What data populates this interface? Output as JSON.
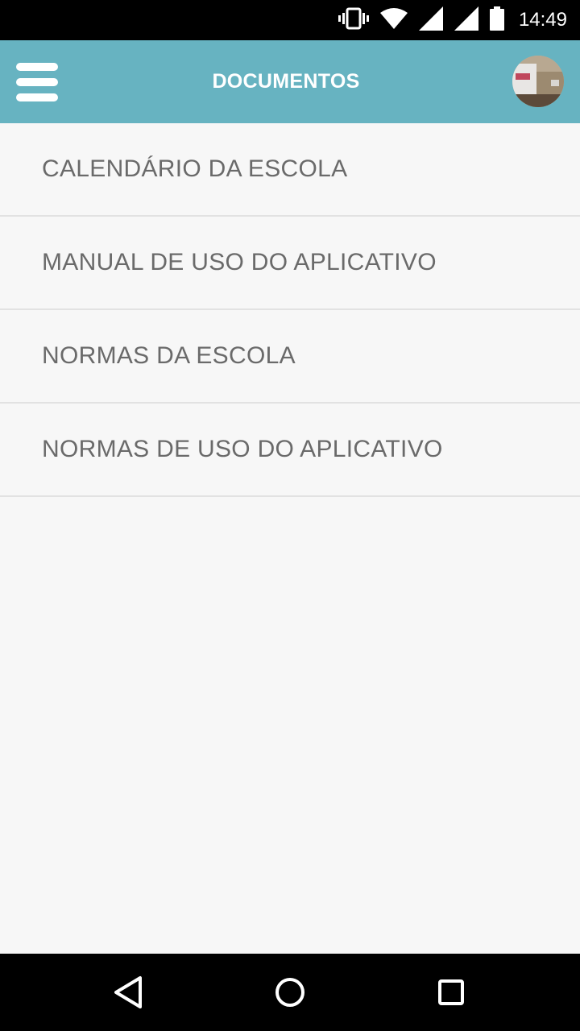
{
  "status_bar": {
    "time": "14:49",
    "icons": [
      "vibrate-icon",
      "wifi-icon",
      "signal-icon",
      "signal-icon",
      "battery-icon"
    ]
  },
  "app_bar": {
    "title": "DOCUMENTOS",
    "menu_icon": "hamburger-menu-icon",
    "avatar": "user-avatar"
  },
  "documents": [
    {
      "label": "CALENDÁRIO DA ESCOLA"
    },
    {
      "label": "MANUAL DE USO DO APLICATIVO"
    },
    {
      "label": "NORMAS DA ESCOLA"
    },
    {
      "label": "NORMAS DE USO DO APLICATIVO"
    }
  ],
  "nav_bar": {
    "buttons": [
      "back-icon",
      "home-icon",
      "recents-icon"
    ]
  },
  "colors": {
    "app_bar": "#67b3c1",
    "background": "#f7f7f7",
    "item_text": "#6a6a6a",
    "divider": "#e2e2e2"
  }
}
